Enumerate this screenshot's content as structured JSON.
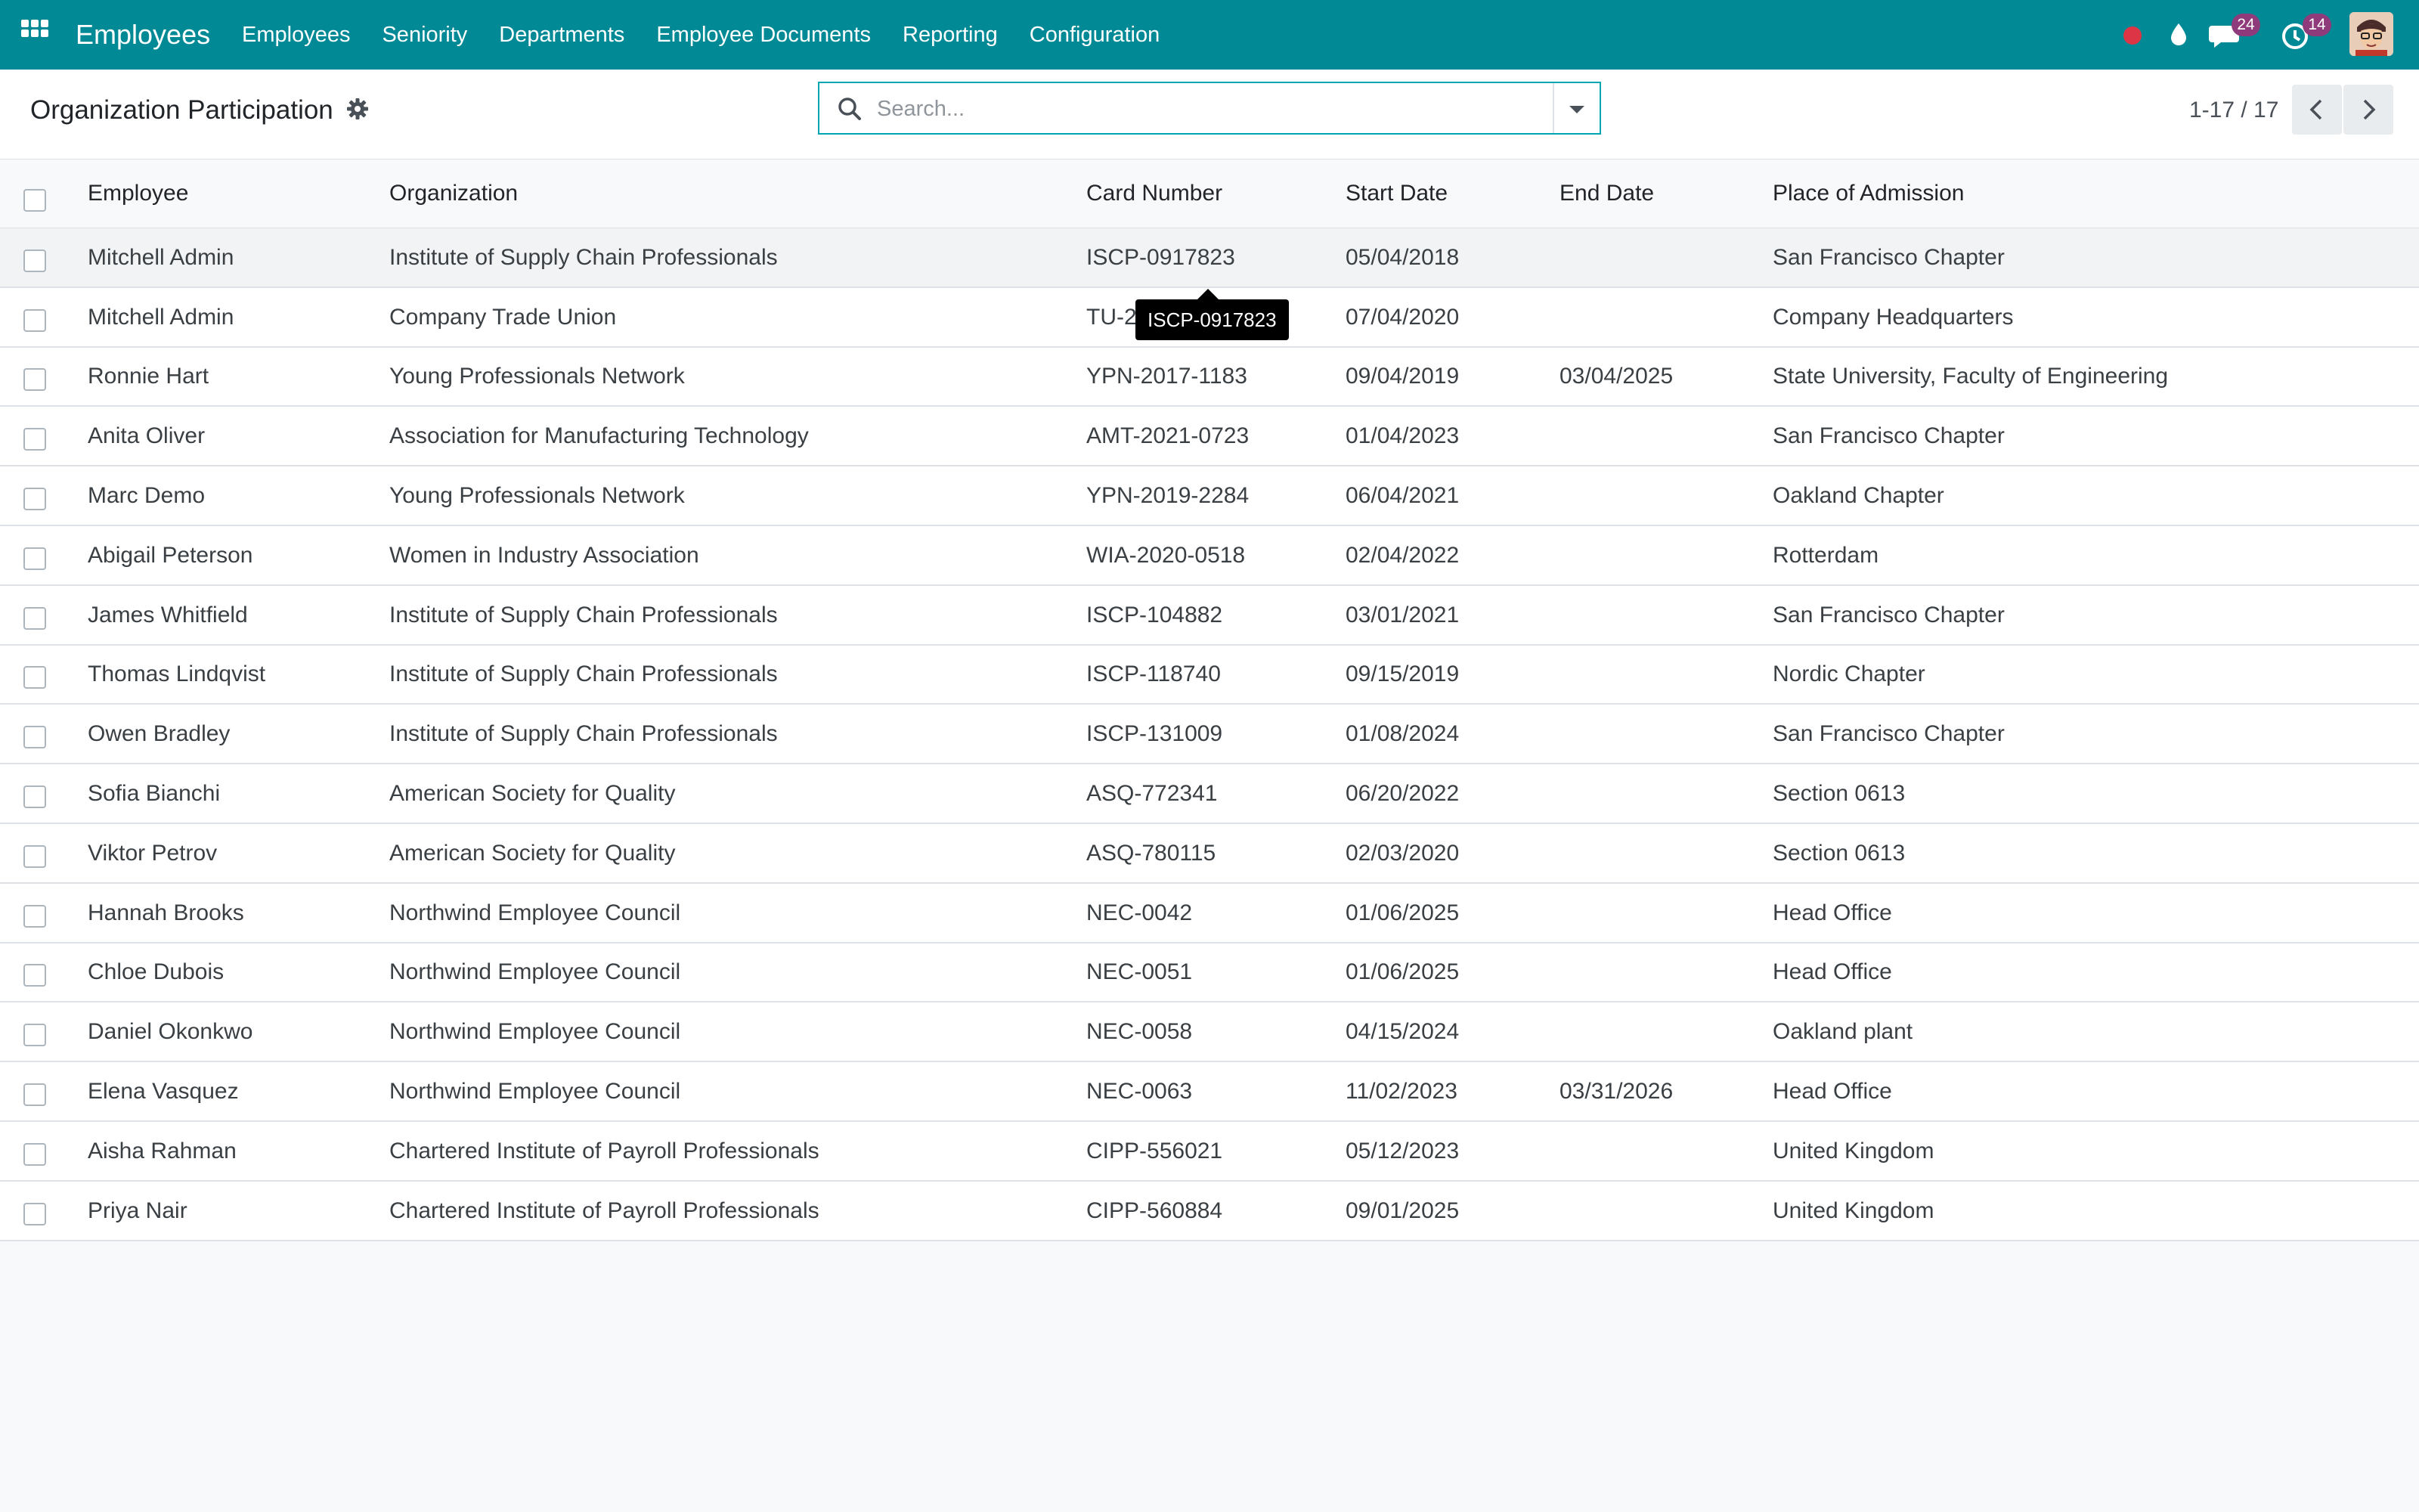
{
  "app": {
    "brand": "Employees",
    "menu": [
      "Employees",
      "Seniority",
      "Departments",
      "Employee Documents",
      "Reporting",
      "Configuration"
    ]
  },
  "systray": {
    "messages_count": "24",
    "activities_count": "14",
    "icons": [
      "record-dot",
      "droplet-icon",
      "chat-icon",
      "clock-icon",
      "avatar"
    ]
  },
  "control_panel": {
    "title": "Organization Participation",
    "search_placeholder": "Search...",
    "pager": "1-17 / 17"
  },
  "table": {
    "columns": [
      "Employee",
      "Organization",
      "Card Number",
      "Start Date",
      "End Date",
      "Place of Admission"
    ],
    "rows": [
      [
        "Mitchell Admin",
        "Institute of Supply Chain Professionals",
        "ISCP-0917823",
        "05/04/2018",
        "",
        "San Francisco Chapter"
      ],
      [
        "Mitchell Admin",
        "Company Trade Union",
        "TU-2",
        "07/04/2020",
        "",
        "Company Headquarters"
      ],
      [
        "Ronnie Hart",
        "Young Professionals Network",
        "YPN-2017-1183",
        "09/04/2019",
        "03/04/2025",
        "State University, Faculty of Engineering"
      ],
      [
        "Anita Oliver",
        "Association for Manufacturing Technology",
        "AMT-2021-0723",
        "01/04/2023",
        "",
        "San Francisco Chapter"
      ],
      [
        "Marc Demo",
        "Young Professionals Network",
        "YPN-2019-2284",
        "06/04/2021",
        "",
        "Oakland Chapter"
      ],
      [
        "Abigail Peterson",
        "Women in Industry Association",
        "WIA-2020-0518",
        "02/04/2022",
        "",
        "Rotterdam"
      ],
      [
        "James Whitfield",
        "Institute of Supply Chain Professionals",
        "ISCP-104882",
        "03/01/2021",
        "",
        "San Francisco Chapter"
      ],
      [
        "Thomas Lindqvist",
        "Institute of Supply Chain Professionals",
        "ISCP-118740",
        "09/15/2019",
        "",
        "Nordic Chapter"
      ],
      [
        "Owen Bradley",
        "Institute of Supply Chain Professionals",
        "ISCP-131009",
        "01/08/2024",
        "",
        "San Francisco Chapter"
      ],
      [
        "Sofia Bianchi",
        "American Society for Quality",
        "ASQ-772341",
        "06/20/2022",
        "",
        "Section 0613"
      ],
      [
        "Viktor Petrov",
        "American Society for Quality",
        "ASQ-780115",
        "02/03/2020",
        "",
        "Section 0613"
      ],
      [
        "Hannah Brooks",
        "Northwind Employee Council",
        "NEC-0042",
        "01/06/2025",
        "",
        "Head Office"
      ],
      [
        "Chloe Dubois",
        "Northwind Employee Council",
        "NEC-0051",
        "01/06/2025",
        "",
        "Head Office"
      ],
      [
        "Daniel Okonkwo",
        "Northwind Employee Council",
        "NEC-0058",
        "04/15/2024",
        "",
        "Oakland plant"
      ],
      [
        "Elena Vasquez",
        "Northwind Employee Council",
        "NEC-0063",
        "11/02/2023",
        "03/31/2026",
        "Head Office"
      ],
      [
        "Aisha Rahman",
        "Chartered Institute of Payroll Professionals",
        "CIPP-556021",
        "05/12/2023",
        "",
        "United Kingdom"
      ],
      [
        "Priya Nair",
        "Chartered Institute of Payroll Professionals",
        "CIPP-560884",
        "09/01/2025",
        "",
        "United Kingdom"
      ]
    ]
  },
  "tooltip": "ISCP-0917823",
  "colors": {
    "navbar": "#018a96",
    "search_border": "#01a6b4",
    "badge": "#8f3a7a",
    "record": "#dc3545"
  }
}
